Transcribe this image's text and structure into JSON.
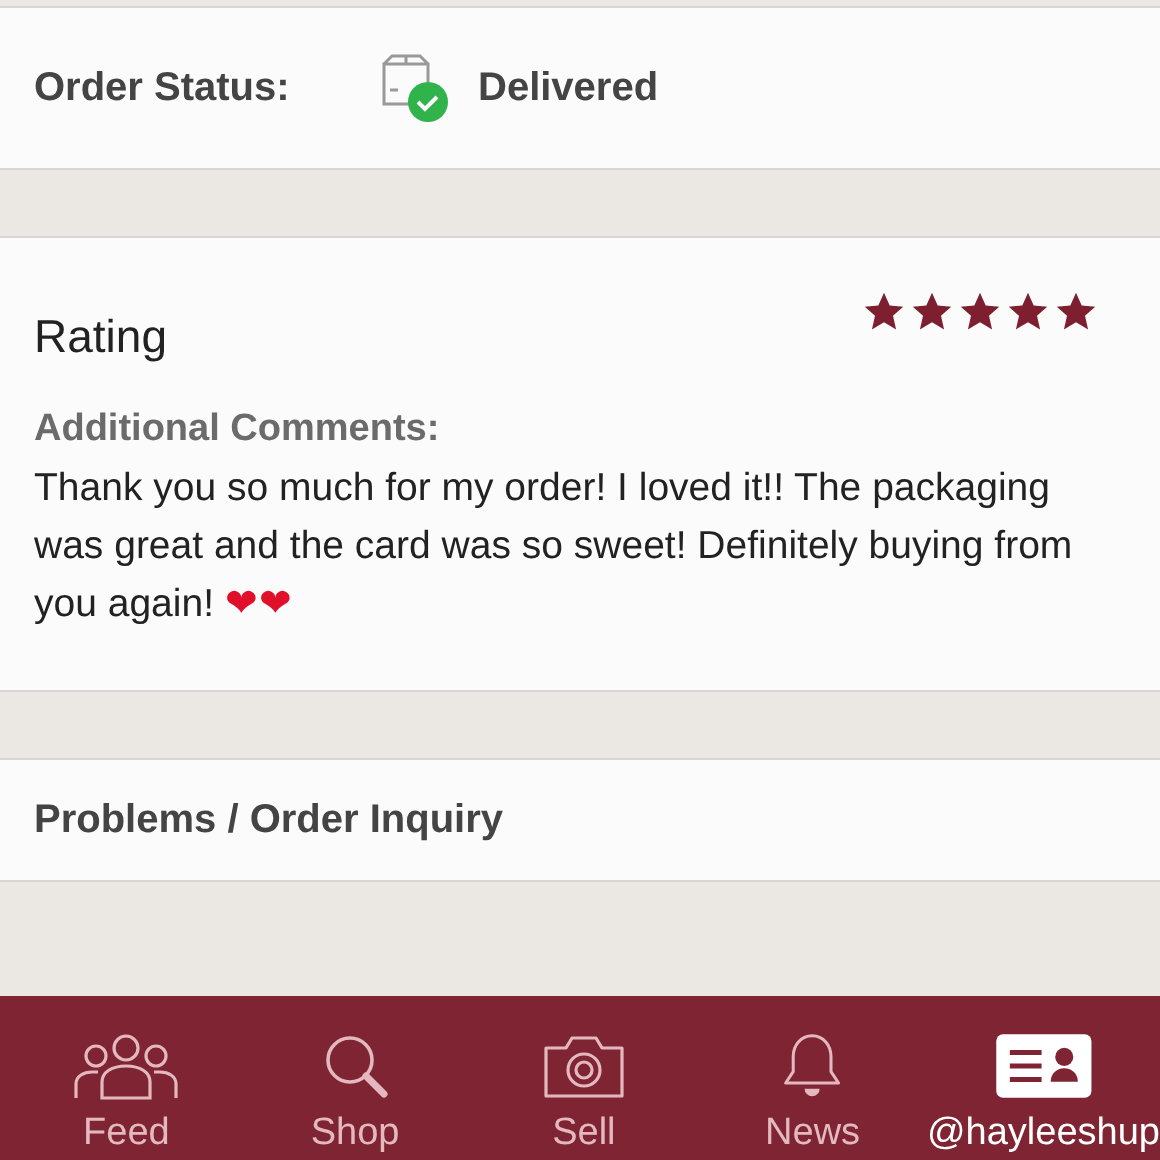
{
  "order_status": {
    "label": "Order Status:",
    "value": "Delivered"
  },
  "rating": {
    "title": "Rating",
    "stars": 5,
    "comments_label": "Additional Comments:",
    "comment": "Thank you so much for my order! I loved it!! The packaging was great and the card was so sweet! Definitely buying from you again! ",
    "emoji": "❤❤"
  },
  "problems": {
    "label": "Problems / Order Inquiry"
  },
  "nav": [
    {
      "kind": "feed",
      "label": "Feed",
      "selected": false
    },
    {
      "kind": "shop",
      "label": "Shop",
      "selected": false
    },
    {
      "kind": "sell",
      "label": "Sell",
      "selected": false
    },
    {
      "kind": "news",
      "label": "News",
      "selected": false
    },
    {
      "kind": "profile",
      "label": "@hayleeshup",
      "selected": true
    }
  ]
}
